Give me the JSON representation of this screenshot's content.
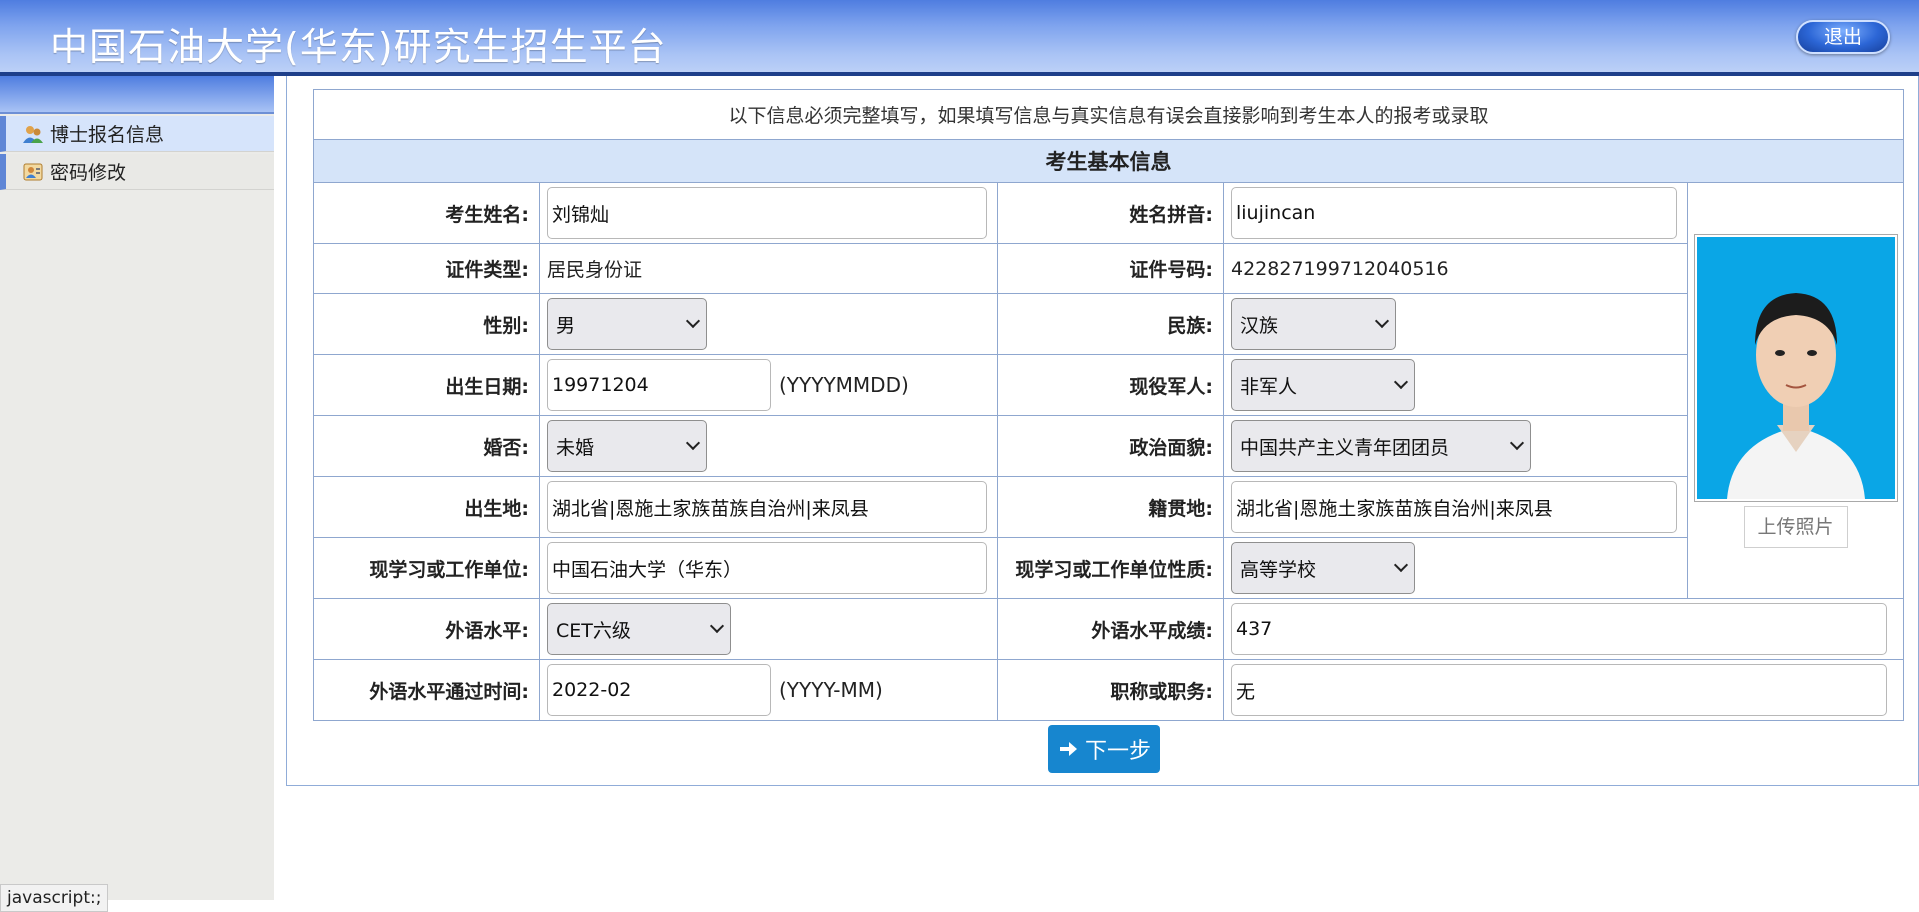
{
  "header": {
    "title": "中国石油大学(华东)研究生招生平台",
    "logout_label": "退出"
  },
  "sidebar": {
    "items": [
      {
        "label": "博士报名信息"
      },
      {
        "label": "密码修改"
      }
    ]
  },
  "notice": "以下信息必须完整填写，如果填写信息与真实信息有误会直接影响到考生本人的报考或录取",
  "section_title": "考生基本信息",
  "form": {
    "name": {
      "label": "考生姓名:",
      "value": "刘锦灿"
    },
    "pinyin": {
      "label": "姓名拼音:",
      "value": "liujincan"
    },
    "id_type": {
      "label": "证件类型:",
      "value": "居民身份证"
    },
    "id_number": {
      "label": "证件号码:",
      "value": "422827199712040516"
    },
    "gender": {
      "label": "性别:",
      "value": "男"
    },
    "ethnicity": {
      "label": "民族:",
      "value": "汉族"
    },
    "birth_date": {
      "label": "出生日期:",
      "value": "19971204",
      "hint": "(YYYYMMDD)"
    },
    "military": {
      "label": "现役军人:",
      "value": "非军人"
    },
    "marital": {
      "label": "婚否:",
      "value": "未婚"
    },
    "political": {
      "label": "政治面貌:",
      "value": "中国共产主义青年团团员"
    },
    "birthplace": {
      "label": "出生地:",
      "value": "湖北省|恩施土家族苗族自治州|来凤县"
    },
    "native_place": {
      "label": "籍贯地:",
      "value": "湖北省|恩施土家族苗族自治州|来凤县"
    },
    "work_unit": {
      "label": "现学习或工作单位:",
      "value": "中国石油大学（华东）"
    },
    "work_unit_type": {
      "label": "现学习或工作单位性质:",
      "value": "高等学校"
    },
    "foreign_level": {
      "label": "外语水平:",
      "value": "CET六级"
    },
    "foreign_score": {
      "label": "外语水平成绩:",
      "value": "437"
    },
    "foreign_pass_time": {
      "label": "外语水平通过时间:",
      "value": "2022-02",
      "hint": "(YYYY-MM)"
    },
    "title": {
      "label": "职称或职务:",
      "value": "无"
    }
  },
  "photo": {
    "upload_label": "上传照片"
  },
  "next_label": "下一步",
  "status_bar": "javascript:;"
}
